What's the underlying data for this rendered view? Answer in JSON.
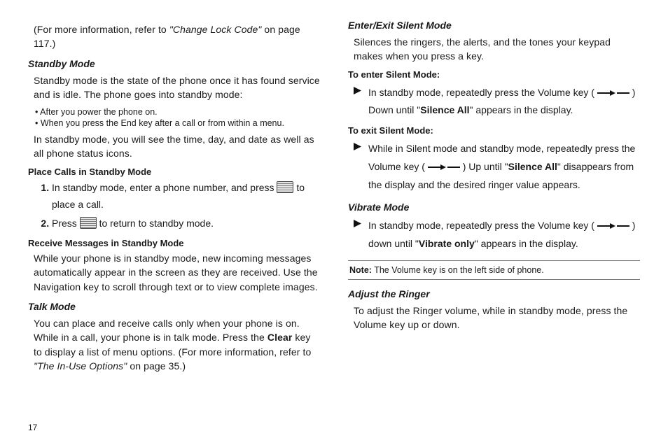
{
  "left": {
    "intro_prefix": "(For more information, refer to ",
    "intro_ref": "\"Change Lock Code\"",
    "intro_suffix": "  on page 117.)",
    "standby": {
      "title": "Standby Mode",
      "para1": "Standby mode is the state of the phone once it has found service and is idle. The phone goes into standby mode:",
      "bullet1": "After you power the phone on.",
      "bullet2": "When you press the End key after a call or from within a menu.",
      "para2": "In standby mode, you will see the time, day, and date as well as all phone status icons.",
      "place_title": "Place Calls in Standby Mode",
      "step1_a": "In standby mode, enter a phone number, and press ",
      "step1_b": " to place a call.",
      "step2_a": "Press ",
      "step2_b": " to return to standby mode.",
      "recv_title": "Receive Messages in Standby Mode",
      "recv_para": "While your phone is in standby mode, new incoming messages automatically appear in the screen as they are received. Use the Navigation key to scroll through text or to view complete images."
    },
    "talk": {
      "title": "Talk Mode",
      "para_a": "You can place and receive calls only when your phone is on. While in a call, your phone is in talk mode. Press the ",
      "clear": "Clear",
      "para_b": " key to display a list of menu options. (For more information, refer to ",
      "ref": "\"The In-Use Options\"",
      "para_c": "  on page 35.)"
    },
    "page_number": "17"
  },
  "right": {
    "silent": {
      "title": "Enter/Exit Silent Mode",
      "para": "Silences the ringers, the alerts, and the tones your keypad makes when you press a key.",
      "enter_title": "To enter Silent Mode:",
      "enter_a": "In standby mode, repeatedly press the Volume key ( ",
      "enter_b": " ) Down until \"",
      "silence_all": "Silence All",
      "enter_c": "\" appears in the display.",
      "exit_title": "To exit Silent Mode:",
      "exit_a": "While in Silent mode and standby mode, repeatedly press the Volume key ( ",
      "exit_b": " ) Up until \"",
      "exit_c": "\" disappears from the display and the desired ringer value appears."
    },
    "vibrate": {
      "title": "Vibrate Mode",
      "a": "In standby mode, repeatedly press the Volume key ( ",
      "b": " ) down until \"",
      "vonly": "Vibrate only",
      "c": "\" appears in the display."
    },
    "note": {
      "label": "Note:",
      "text": " The Volume key is on the left side of phone."
    },
    "ringer": {
      "title": "Adjust the Ringer",
      "para": "To adjust the Ringer volume, while in standby mode, press the Volume key up or down."
    }
  }
}
